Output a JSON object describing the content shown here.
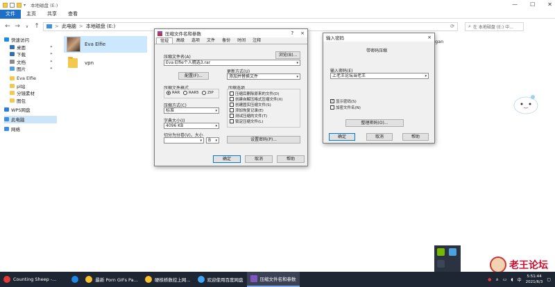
{
  "window": {
    "title": "本地磁盘 (E:)",
    "ribbon_tabs": [
      "文件",
      "主页",
      "共享",
      "查看"
    ],
    "address": {
      "parts": [
        "此电脑",
        "本地磁盘 (E:)"
      ],
      "arrow": ">"
    },
    "search_placeholder": "在 本地磁盘 (E:) 中..."
  },
  "sidebar": {
    "items": [
      {
        "label": "快速访问",
        "color": "#1e88e5",
        "pinned": false
      },
      {
        "label": "桌面",
        "color": "#2e6fb7",
        "pinned": true
      },
      {
        "label": "下载",
        "color": "#2e6fb7",
        "pinned": true
      },
      {
        "label": "文档",
        "color": "#8a8a8a",
        "pinned": true
      },
      {
        "label": "图片",
        "color": "#4fa0d8",
        "pinned": true
      },
      {
        "label": "Eva Elfie",
        "color": "#f2c94c",
        "pinned": false
      },
      {
        "label": "pl站",
        "color": "#f2c94c",
        "pinned": false
      },
      {
        "label": "分镜素材",
        "color": "#f2c94c",
        "pinned": false
      },
      {
        "label": "图包",
        "color": "#f2c94c",
        "pinned": false
      },
      {
        "label": "WPS网盘",
        "color": "#2a7be4",
        "pinned": false
      },
      {
        "label": "此电脑",
        "color": "#3a8ee6",
        "pinned": false,
        "selected": true
      },
      {
        "label": "网络",
        "color": "#3a8ee6",
        "pinned": false
      }
    ]
  },
  "files": [
    {
      "name": "Eva Elfie",
      "kind": "folder-thumb",
      "selected": true
    },
    {
      "name": "vpn",
      "kind": "folder"
    }
  ],
  "partial_text": "gan",
  "archive_dialog": {
    "title": "压缩文件名和参数",
    "help": "?",
    "close": "×",
    "tabs": [
      "常规",
      "高级",
      "选项",
      "文件",
      "备份",
      "时间",
      "注释"
    ],
    "archive_name_label": "压缩文件名(A)",
    "browse_btn": "浏览(B)...",
    "archive_name_value": "Eva Elfie个人精选3.rar",
    "profiles_btn": "配置(F)...",
    "update_label": "更新方式(U)",
    "update_value": "添加并替换文件",
    "format_label": "压缩文件格式",
    "formats": [
      {
        "label": "RAR",
        "on": true
      },
      {
        "label": "RAR5",
        "on": false
      },
      {
        "label": "ZIP",
        "on": false
      }
    ],
    "method_label": "压缩方式(C)",
    "method_value": "标准",
    "dict_label": "字典大小(I)",
    "dict_value": "4096 KB",
    "split_label": "切分为分卷(V)，大小",
    "split_value": "",
    "split_unit": "B",
    "options_label": "压缩选项",
    "options": [
      "压缩后删除原来的文件(D)",
      "创建自解压格式压缩文件(X)",
      "创建固实压缩文件(S)",
      "添加恢复记录(E)",
      "测试压缩的文件(T)",
      "锁定压缩文件(L)"
    ],
    "password_btn": "设置密码(P)...",
    "ok": "确定",
    "cancel": "取消",
    "help_btn": "帮助"
  },
  "password_dialog": {
    "title": "输入密码",
    "close": "×",
    "heading": "带密码压缩",
    "input_label": "输入密码(E)",
    "input_value": "上老王论坛当老王",
    "show_password": {
      "label": "显示密码(S)",
      "checked": true
    },
    "encrypt_names": {
      "label": "加密文件名(N)",
      "checked": false
    },
    "organize_btn": "整理密码(O)...",
    "ok": "确定",
    "cancel": "取消",
    "help": "帮助"
  },
  "taskbar": {
    "items": [
      {
        "label": "Counting Sheep -...",
        "color": "#e53935"
      },
      {
        "label": "",
        "color": "#1e88e5"
      },
      {
        "label": "最新 Porn GIFs Pa...",
        "color": "#fbc02d"
      },
      {
        "label": "硬核桥数控上网...",
        "color": "#fbc02d"
      },
      {
        "label": "欢迎使用百度网盘",
        "color": "#42a5f5"
      },
      {
        "label": "压缩文件名和参数",
        "color": "#7e57c2",
        "active": true
      }
    ],
    "clock_time": "5:51:44",
    "clock_date": "2021/6/3"
  },
  "watermark": {
    "text": "老王论坛"
  }
}
